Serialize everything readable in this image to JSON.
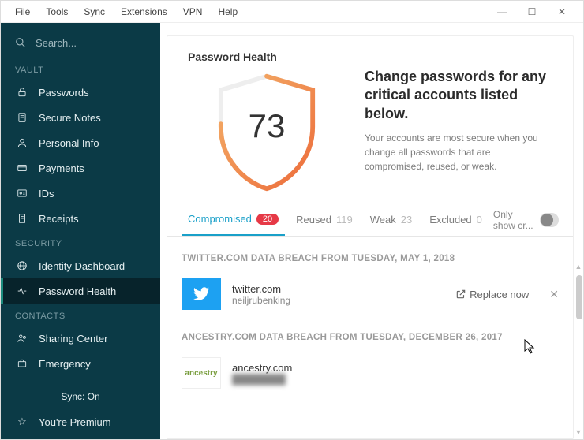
{
  "menubar": {
    "items": [
      "File",
      "Tools",
      "Sync",
      "Extensions",
      "VPN",
      "Help"
    ]
  },
  "window_controls": {
    "min": "—",
    "max": "☐",
    "close": "✕"
  },
  "sidebar": {
    "search_placeholder": "Search...",
    "sections": {
      "vault": {
        "label": "VAULT",
        "items": [
          {
            "label": "Passwords",
            "icon": "lock-icon"
          },
          {
            "label": "Secure Notes",
            "icon": "note-icon"
          },
          {
            "label": "Personal Info",
            "icon": "person-icon"
          },
          {
            "label": "Payments",
            "icon": "card-icon"
          },
          {
            "label": "IDs",
            "icon": "id-icon"
          },
          {
            "label": "Receipts",
            "icon": "receipt-icon"
          }
        ]
      },
      "security": {
        "label": "SECURITY",
        "items": [
          {
            "label": "Identity Dashboard",
            "icon": "globe-icon"
          },
          {
            "label": "Password Health",
            "icon": "heartbeat-icon",
            "active": true
          }
        ]
      },
      "contacts": {
        "label": "CONTACTS",
        "items": [
          {
            "label": "Sharing Center",
            "icon": "people-icon"
          },
          {
            "label": "Emergency",
            "icon": "briefcase-icon"
          }
        ]
      }
    },
    "bottom": {
      "sync": "Sync: On",
      "premium": "You're Premium"
    }
  },
  "health": {
    "title": "Password Health",
    "score": "73",
    "heading": "Change passwords for any critical accounts listed below.",
    "sub": "Your accounts are most secure when you change all passwords that are compromised, reused, or weak."
  },
  "tabs": {
    "compromised": {
      "label": "Compromised",
      "count": "20"
    },
    "reused": {
      "label": "Reused",
      "count": "119"
    },
    "weak": {
      "label": "Weak",
      "count": "23"
    },
    "excluded": {
      "label": "Excluded",
      "count": "0"
    },
    "only_critical": "Only show cr..."
  },
  "breaches": [
    {
      "header": "TWITTER.COM DATA BREACH FROM TUESDAY, MAY 1, 2018",
      "site": "twitter.com",
      "user": "neiljrubenking",
      "logo": "twitter",
      "action": "Replace now"
    },
    {
      "header": "ANCESTRY.COM DATA BREACH FROM TUESDAY, DECEMBER 26, 2017",
      "site": "ancestry.com",
      "user": "████████",
      "logo": "ancestry",
      "blur": true
    }
  ]
}
